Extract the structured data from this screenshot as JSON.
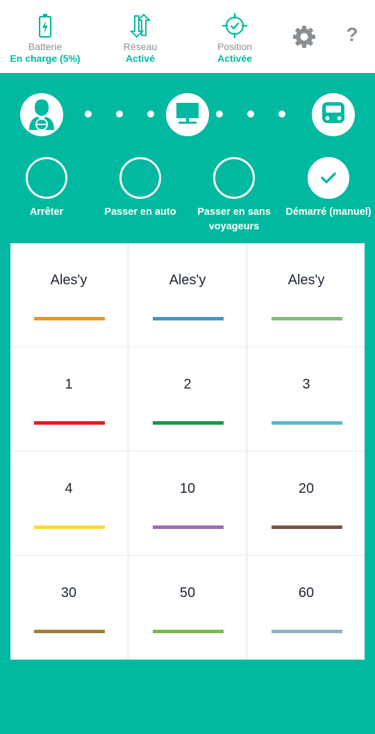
{
  "status_bar": {
    "battery": {
      "label": "Batterie",
      "value": "En charge (5%)",
      "icon": "battery-charging-icon"
    },
    "network": {
      "label": "Réseau",
      "value": "Activé",
      "icon": "network-arrows-icon"
    },
    "position": {
      "label": "Position",
      "value": "Activée",
      "icon": "gps-crosshair-icon"
    },
    "settings_icon": "gear-icon",
    "help_label": "?"
  },
  "steps": [
    "driver-icon",
    "terminal-icon",
    "bus-icon"
  ],
  "modes": [
    {
      "label": "Arrêter",
      "active": false
    },
    {
      "label": "Passer en auto",
      "active": false
    },
    {
      "label": "Passer en sans voyageurs",
      "active": false
    },
    {
      "label": "Démarré (manuel)",
      "active": true
    }
  ],
  "lines": [
    {
      "name": "Ales'y",
      "color": "#e8952a"
    },
    {
      "name": "Ales'y",
      "color": "#4596c8"
    },
    {
      "name": "Ales'y",
      "color": "#80bf78"
    },
    {
      "name": "1",
      "color": "#e8191c"
    },
    {
      "name": "2",
      "color": "#0b9a4a"
    },
    {
      "name": "3",
      "color": "#5ab8d2"
    },
    {
      "name": "4",
      "color": "#fbd93b"
    },
    {
      "name": "10",
      "color": "#a06ab0"
    },
    {
      "name": "20",
      "color": "#7b5246"
    },
    {
      "name": "30",
      "color": "#a07d3a"
    },
    {
      "name": "50",
      "color": "#79b94d"
    },
    {
      "name": "60",
      "color": "#92b2c6"
    }
  ],
  "colors": {
    "accent": "#00b9a0",
    "muted": "#8a8f93"
  }
}
